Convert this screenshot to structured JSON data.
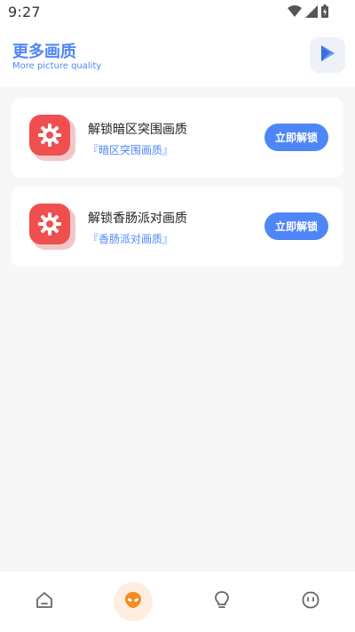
{
  "status_bar": {
    "time": "9:27",
    "icons": [
      "wifi-icon",
      "cell-signal-icon",
      "battery-icon"
    ]
  },
  "header": {
    "title": "更多画质",
    "subtitle": "More picture quality",
    "action_icon": "play-store-icon"
  },
  "cards": [
    {
      "icon": "settings-gear-icon",
      "title": "解锁暗区突围画质",
      "description": "『暗区突围画质』",
      "button_label": "立即解锁"
    },
    {
      "icon": "settings-gear-icon",
      "title": "解锁香肠派对画质",
      "description": "『香肠派对画质』",
      "button_label": "立即解锁"
    }
  ],
  "bottom_nav": {
    "items": [
      "home-icon",
      "alien-icon",
      "lightbulb-icon",
      "face-icon"
    ],
    "active_index": 1
  },
  "colors": {
    "accent": "#4f86f7",
    "card_icon": "#f04f4f",
    "active_nav_bg": "#fdeee0",
    "active_nav_icon": "#f58a1f"
  }
}
